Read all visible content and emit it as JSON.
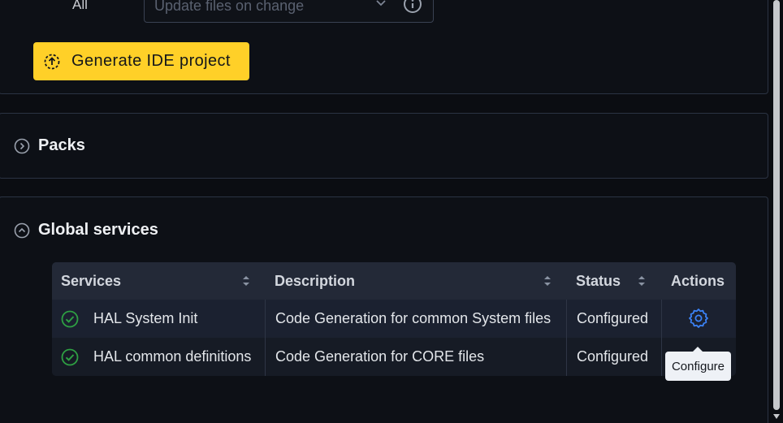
{
  "top_panel": {
    "all_label": "All",
    "update_select": {
      "placeholder": "Update files on change"
    },
    "generate_button": {
      "label": "Generate IDE project"
    }
  },
  "packs": {
    "title": "Packs"
  },
  "global_services": {
    "title": "Global services",
    "table": {
      "headers": {
        "services": "Services",
        "description": "Description",
        "status": "Status",
        "actions": "Actions"
      },
      "rows": [
        {
          "service": "HAL System Init",
          "description": "Code Generation for common System files",
          "status": "Configured"
        },
        {
          "service": "HAL common definitions",
          "description": "Code Generation for CORE files",
          "status": "Configured"
        }
      ]
    },
    "tooltip": "Configure"
  },
  "colors": {
    "accent_button": "#ffd028",
    "check_green": "#2ea043",
    "gear_blue": "#3b82f6"
  },
  "icons": [
    "chevron-down-icon",
    "info-icon",
    "generate-icon",
    "chevron-right-circle-icon",
    "chevron-up-circle-icon",
    "sort-icon",
    "check-circle-icon",
    "gear-icon"
  ]
}
